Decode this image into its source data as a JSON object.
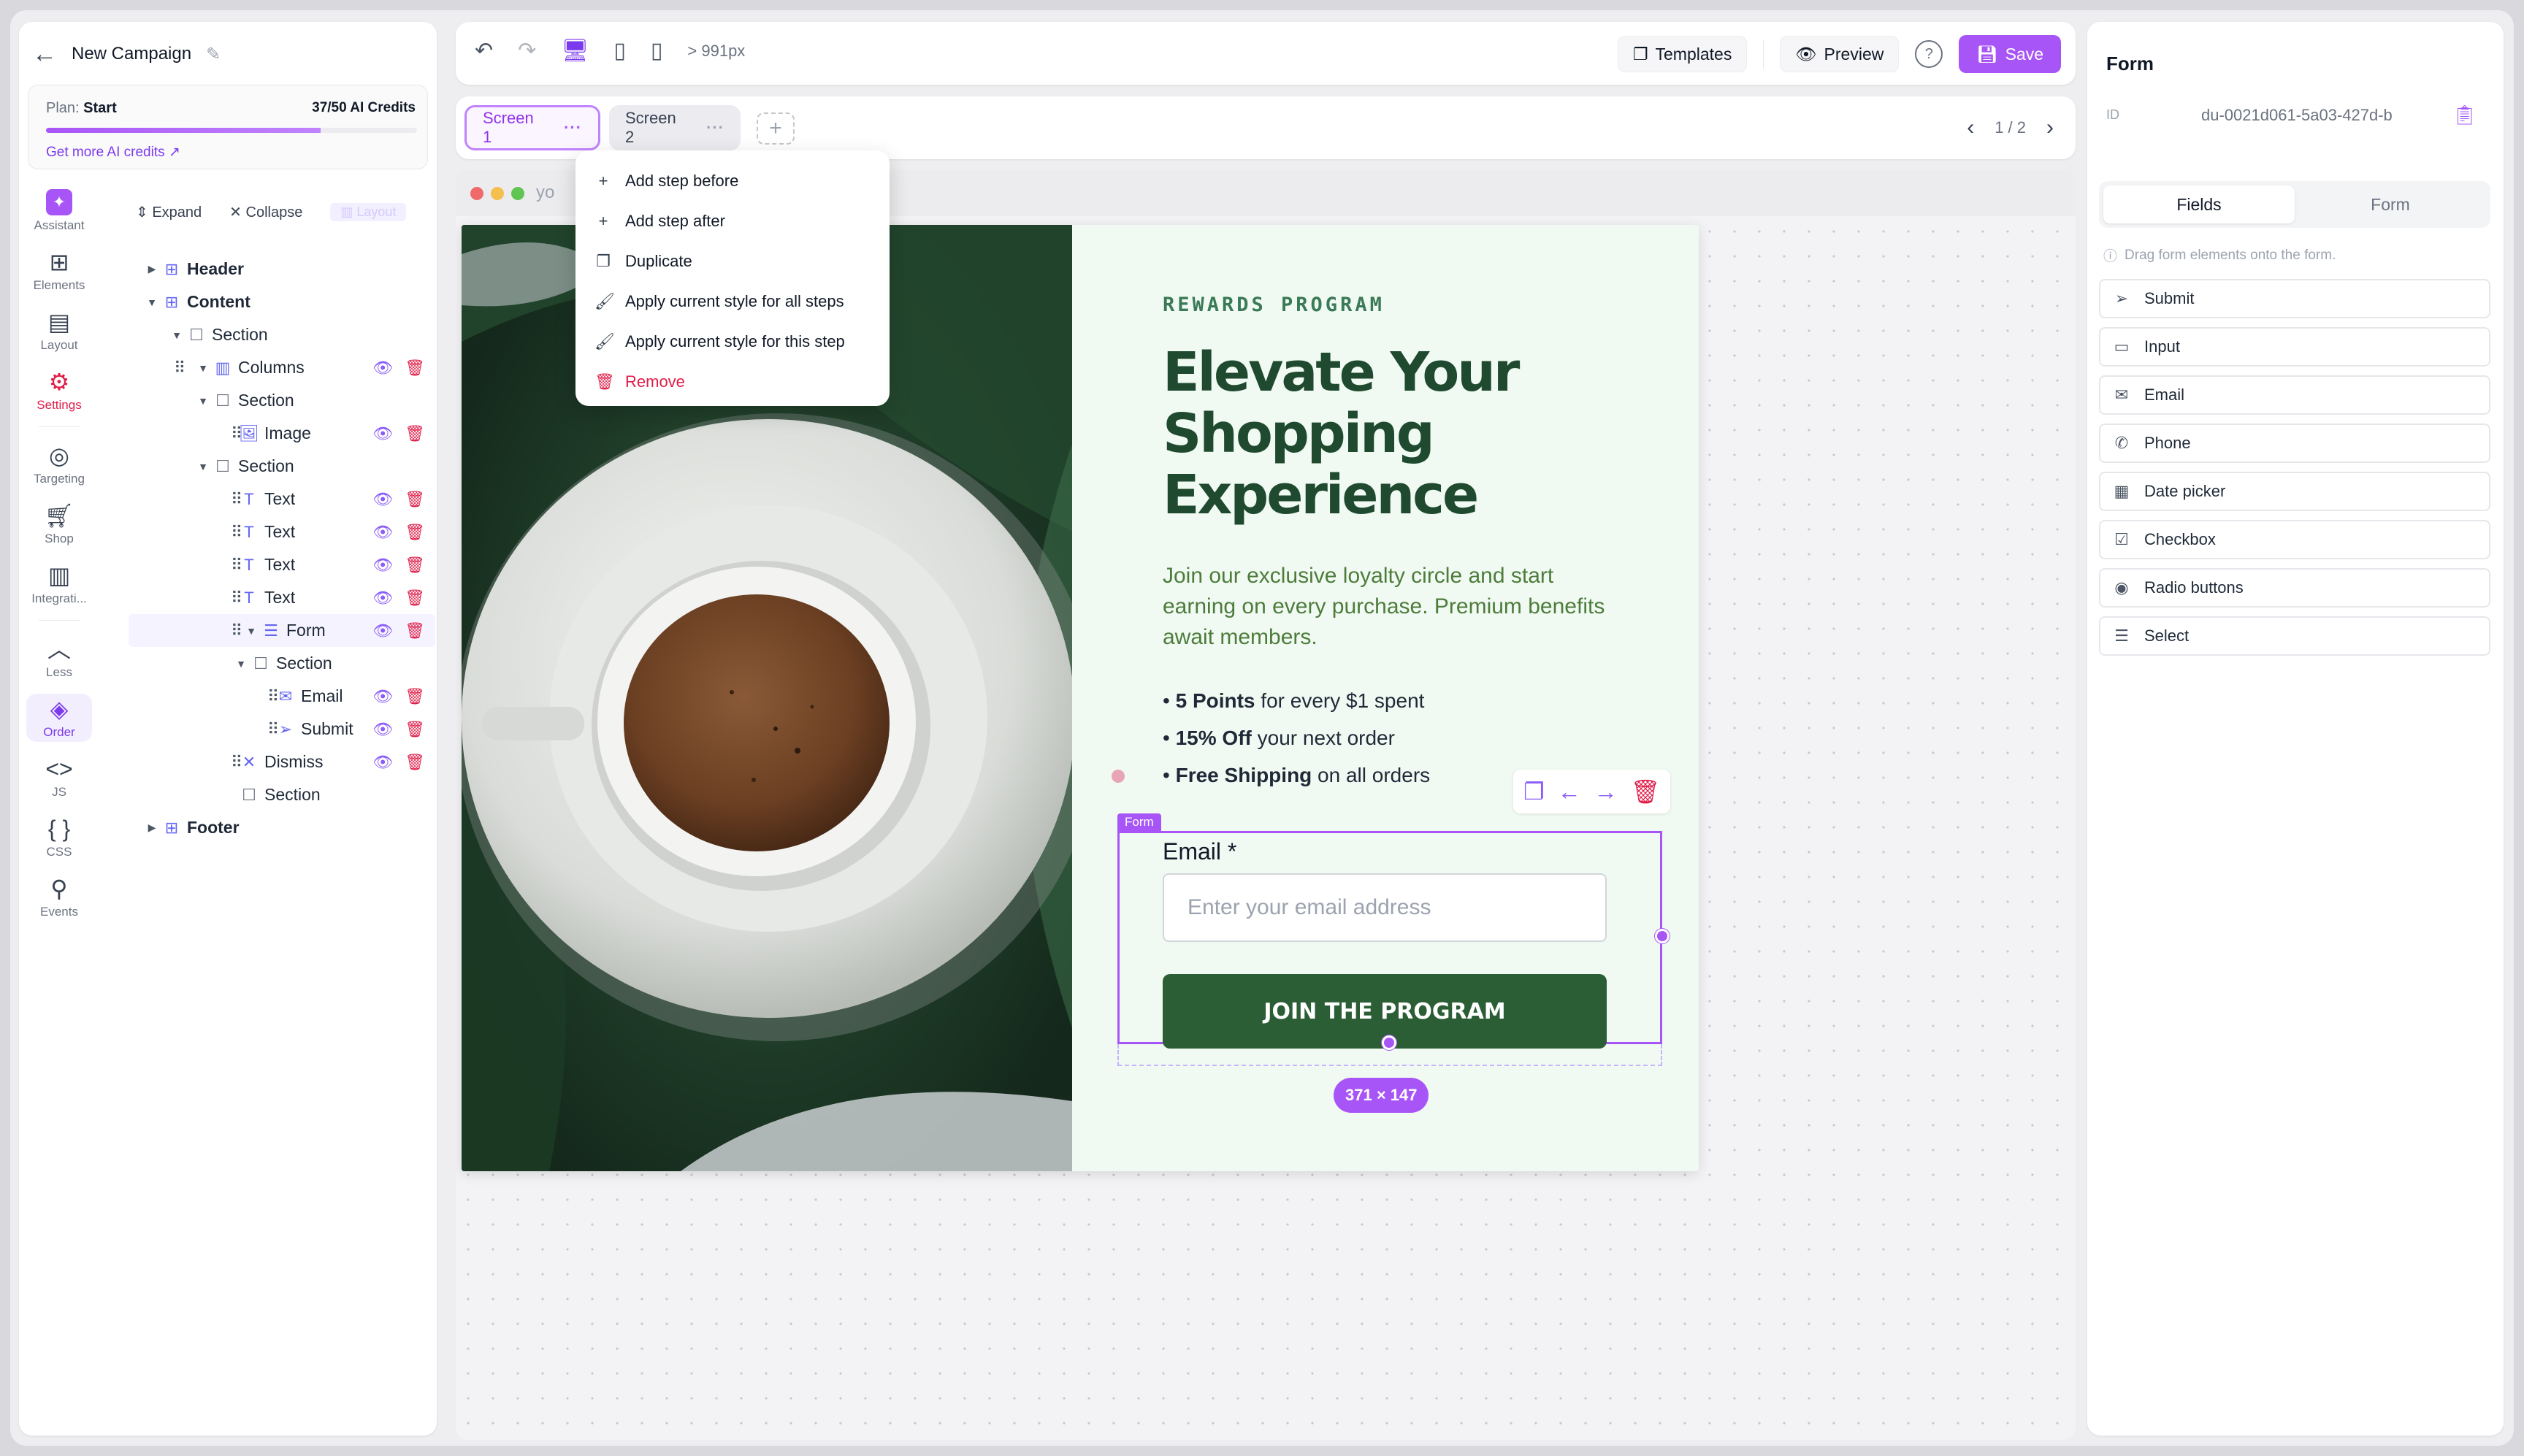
{
  "app": {
    "campaign_title": "New Campaign",
    "plan_label": "Plan:",
    "plan_name": "Start",
    "credits": "37/50 AI Credits",
    "credits_used_fraction": 0.74,
    "more_credits": "Get more AI credits"
  },
  "rail": [
    {
      "label": "Assistant",
      "icon": "sparkle-icon"
    },
    {
      "label": "Elements",
      "icon": "elements-icon"
    },
    {
      "label": "Layout",
      "icon": "layout-icon"
    },
    {
      "label": "Settings",
      "icon": "gear-icon"
    },
    {
      "label": "Targeting",
      "icon": "target-icon"
    },
    {
      "label": "Shop",
      "icon": "cart-icon"
    },
    {
      "label": "Integrati...",
      "icon": "chart-icon"
    },
    {
      "label": "Less",
      "icon": "chevron-up-icon"
    },
    {
      "label": "Order",
      "icon": "layers-icon"
    },
    {
      "label": "JS",
      "icon": "code-icon"
    },
    {
      "label": "CSS",
      "icon": "braces-icon"
    },
    {
      "label": "Events",
      "icon": "webhook-icon"
    }
  ],
  "tree": {
    "expand": "Expand",
    "collapse": "Collapse",
    "ghost_label": "Layout",
    "nodes": [
      {
        "label": "Header"
      },
      {
        "label": "Content"
      },
      {
        "label": "Section"
      },
      {
        "label": "Columns"
      },
      {
        "label": "Section"
      },
      {
        "label": "Image"
      },
      {
        "label": "Section"
      },
      {
        "label": "Text"
      },
      {
        "label": "Text"
      },
      {
        "label": "Text"
      },
      {
        "label": "Text"
      },
      {
        "label": "Form"
      },
      {
        "label": "Section"
      },
      {
        "label": "Email"
      },
      {
        "label": "Submit"
      },
      {
        "label": "Dismiss"
      },
      {
        "label": "Section"
      },
      {
        "label": "Footer"
      }
    ]
  },
  "toolbar": {
    "width_readout": "> 991px",
    "templates": "Templates",
    "preview": "Preview",
    "help": "?",
    "save": "Save"
  },
  "tabs": {
    "screen1": "Screen 1",
    "screen2": "Screen 2",
    "dots": "···",
    "add": "+",
    "pager": "1 / 2"
  },
  "context_menu": [
    {
      "label": "Add step before",
      "icon": "plus-icon"
    },
    {
      "label": "Add step after",
      "icon": "plus-icon"
    },
    {
      "label": "Duplicate",
      "icon": "copy-icon"
    },
    {
      "label": "Apply current style for all steps",
      "icon": "brush-icon"
    },
    {
      "label": "Apply current style for this step",
      "icon": "brush-icon"
    },
    {
      "label": "Remove",
      "icon": "trash-icon"
    }
  ],
  "browser": {
    "url_fragment": "yo"
  },
  "popup": {
    "eyebrow": "REWARDS PROGRAM",
    "headline": "Elevate Your Shopping Experience",
    "description": "Join our exclusive loyalty circle and start earning on every purchase. Premium benefits await members.",
    "benefits": [
      {
        "bold": "5 Points",
        "rest": " for every $1 spent"
      },
      {
        "bold": "15% Off",
        "rest": " your next order"
      },
      {
        "bold": "Free Shipping",
        "rest": " on all orders"
      }
    ],
    "form_tag": "Form",
    "email_label": "Email *",
    "email_placeholder": "Enter your email address",
    "submit": "JOIN THE PROGRAM",
    "size_badge": "371 × 147"
  },
  "right_panel": {
    "title": "Form",
    "id_label": "ID",
    "id_value": "du-0021d061-5a03-427d-b",
    "tab_fields": "Fields",
    "tab_form": "Form",
    "hint": "Drag form elements onto the form.",
    "fields": [
      {
        "label": "Submit",
        "icon": "send-icon"
      },
      {
        "label": "Input",
        "icon": "input-icon"
      },
      {
        "label": "Email",
        "icon": "mail-icon"
      },
      {
        "label": "Phone",
        "icon": "phone-icon"
      },
      {
        "label": "Date picker",
        "icon": "calendar-icon"
      },
      {
        "label": "Checkbox",
        "icon": "checkbox-icon"
      },
      {
        "label": "Radio buttons",
        "icon": "radio-icon"
      },
      {
        "label": "Select",
        "icon": "list-icon"
      }
    ]
  },
  "colors": {
    "accent": "#a855f7",
    "danger": "#e11d48",
    "brand_green": "#2b5e35",
    "popup_bg": "#f0faf2"
  }
}
